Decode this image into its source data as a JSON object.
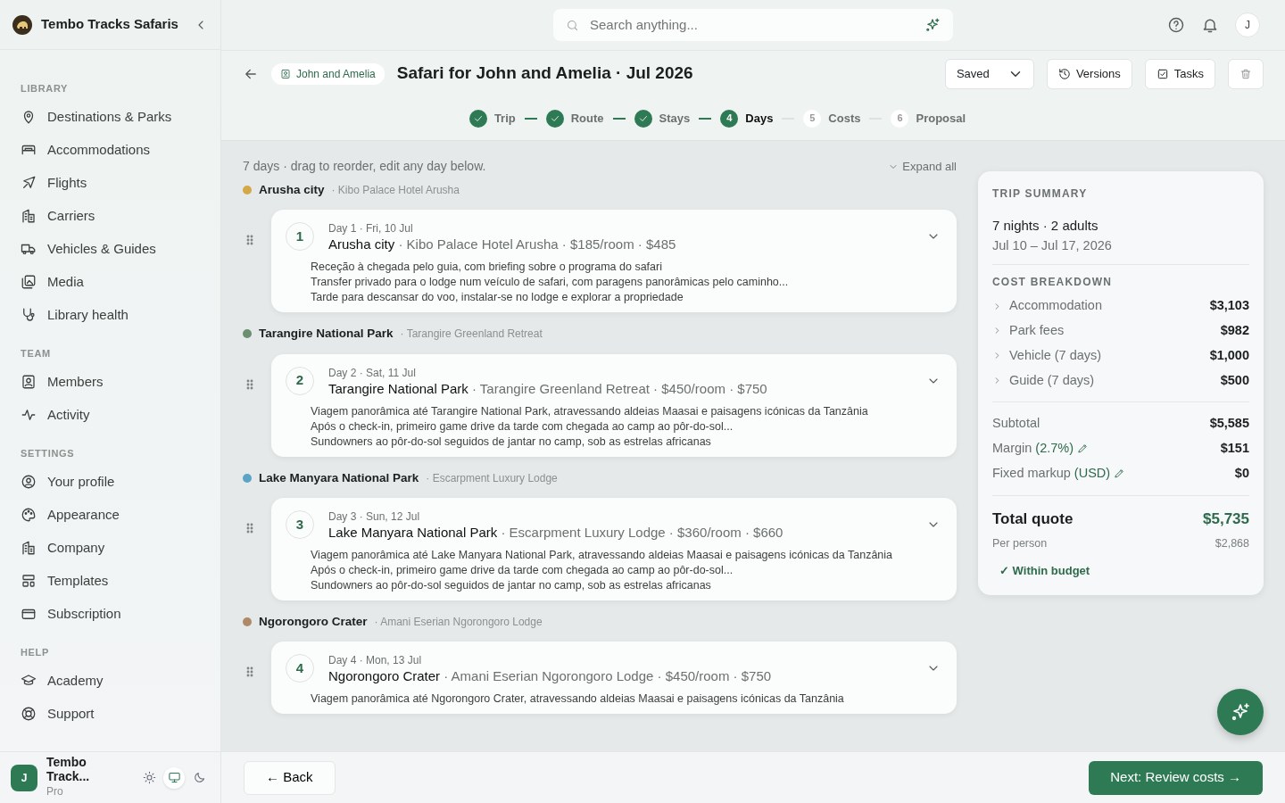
{
  "sidebar": {
    "brand": "Tembo Tracks Safaris",
    "sections": [
      {
        "heading": "LIBRARY",
        "items": [
          {
            "label": "Destinations & Parks"
          },
          {
            "label": "Accommodations"
          },
          {
            "label": "Flights"
          },
          {
            "label": "Carriers"
          },
          {
            "label": "Vehicles & Guides"
          },
          {
            "label": "Media"
          },
          {
            "label": "Library health"
          }
        ]
      },
      {
        "heading": "TEAM",
        "items": [
          {
            "label": "Members"
          },
          {
            "label": "Activity"
          }
        ]
      },
      {
        "heading": "SETTINGS",
        "items": [
          {
            "label": "Your profile"
          },
          {
            "label": "Appearance"
          },
          {
            "label": "Company"
          },
          {
            "label": "Templates"
          },
          {
            "label": "Subscription"
          }
        ]
      },
      {
        "heading": "HELP",
        "items": [
          {
            "label": "Academy"
          },
          {
            "label": "Support"
          }
        ]
      }
    ],
    "user": {
      "initial": "J",
      "name": "Tembo Track...",
      "plan": "Pro"
    },
    "theme_modes": [
      {
        "kind": "light",
        "selected": false
      },
      {
        "kind": "system",
        "selected": true
      },
      {
        "kind": "dark",
        "selected": false
      }
    ]
  },
  "topbar": {
    "search_placeholder": "Search anything...",
    "avatar": "J"
  },
  "trip": {
    "client": "John and Amelia",
    "title": "Safari for John and Amelia · Jul 2026",
    "status": "Saved",
    "buttons": [
      "Versions",
      "Tasks"
    ]
  },
  "steps": [
    {
      "label": "Trip",
      "completed": true,
      "selected": false
    },
    {
      "label": "Route",
      "completed": true,
      "selected": false
    },
    {
      "label": "Stays",
      "completed": true,
      "selected": false
    },
    {
      "number": "4",
      "label": "Days",
      "completed": false,
      "selected": true
    },
    {
      "number": "5",
      "label": "Costs",
      "completed": false,
      "selected": false
    },
    {
      "number": "6",
      "label": "Proposal",
      "completed": false,
      "selected": false
    }
  ],
  "intro": "7 days · drag to reorder, edit any day below.",
  "expand_all": "Expand all",
  "groups": [
    {
      "place": "Arusha city",
      "lodge": "· Kibo Palace Hotel Arusha",
      "color": "#d4a847",
      "day": {
        "number": "1",
        "date": "Day 1 · Fri, 10 Jul",
        "name": "Arusha city",
        "details": "· Kibo Palace Hotel Arusha · $185/room · $485",
        "description": [
          "Receção à chegada pelo guia, com briefing sobre o programa do safari",
          "Transfer privado para o lodge num veículo de safari, com paragens panorâmicas pelo caminho...",
          "Tarde para descansar do voo, instalar-se no lodge e explorar a propriedade"
        ]
      }
    },
    {
      "place": "Tarangire National Park",
      "lodge": "· Tarangire Greenland Retreat",
      "color": "#6b8f71",
      "day": {
        "number": "2",
        "date": "Day 2 · Sat, 11 Jul",
        "name": "Tarangire National Park",
        "details": "· Tarangire Greenland Retreat · $450/room · $750",
        "description": [
          "Viagem panorâmica até Tarangire National Park, atravessando aldeias Maasai e paisagens icónicas da Tanzânia",
          "Após o check-in, primeiro game drive da tarde com chegada ao camp ao pôr-do-sol...",
          "Sundowners ao pôr-do-sol seguidos de jantar no camp, sob as estrelas africanas"
        ]
      }
    },
    {
      "place": "Lake Manyara National Park",
      "lodge": "· Escarpment Luxury Lodge",
      "color": "#5ba4c8",
      "day": {
        "number": "3",
        "date": "Day 3 · Sun, 12 Jul",
        "name": "Lake Manyara National Park",
        "details": "· Escarpment Luxury Lodge · $360/room · $660",
        "description": [
          "Viagem panorâmica até Lake Manyara National Park, atravessando aldeias Maasai e paisagens icónicas da Tanzânia",
          "Após o check-in, primeiro game drive da tarde com chegada ao camp ao pôr-do-sol...",
          "Sundowners ao pôr-do-sol seguidos de jantar no camp, sob as estrelas africanas"
        ]
      }
    },
    {
      "place": "Ngorongoro Crater",
      "lodge": "· Amani Eserian Ngorongoro Lodge",
      "color": "#b08a68",
      "day": {
        "number": "4",
        "date": "Day 4 · Mon, 13 Jul",
        "name": "Ngorongoro Crater",
        "details": "· Amani Eserian Ngorongoro Lodge · $450/room · $750",
        "description": [
          "Viagem panorâmica até Ngorongoro Crater, atravessando aldeias Maasai e paisagens icónicas da Tanzânia"
        ]
      }
    }
  ],
  "summary": {
    "heading": "TRIP SUMMARY",
    "party": "7 nights · 2 adults",
    "dates": "Jul 10 – Jul 17, 2026",
    "cost_heading": "COST BREAKDOWN",
    "costs": [
      {
        "label": "Accommodation",
        "amount": "$3,103"
      },
      {
        "label": "Park fees",
        "amount": "$982"
      },
      {
        "label": "Vehicle (7 days)",
        "amount": "$1,000"
      },
      {
        "label": "Guide (7 days)",
        "amount": "$500"
      }
    ],
    "subtotal": {
      "label": "Subtotal",
      "amount": "$5,585"
    },
    "adjustments": [
      {
        "label": "Margin",
        "value": "(2.7%)",
        "amount": "$151"
      },
      {
        "label": "Fixed markup",
        "value": "(USD)",
        "amount": "$0"
      }
    ],
    "total": {
      "label": "Total quote",
      "amount": "$5,735"
    },
    "per_person": {
      "label": "Per person",
      "amount": "$2,868"
    },
    "budget": "✓ Within budget"
  },
  "footer": {
    "back": "← Back",
    "next": "Next: Review costs →"
  }
}
